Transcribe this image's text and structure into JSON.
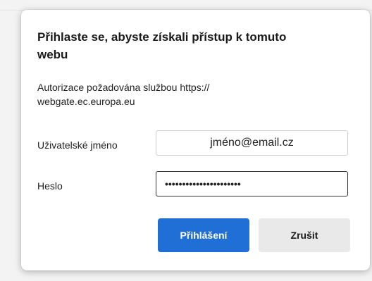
{
  "dialog": {
    "title": "Přihlaste se, abyste získali přístup k tomuto webu",
    "description": "Autorizace požadována službou https:// webgate.ec.europa.eu",
    "username_label": "Uživatelské jméno",
    "username_value": "jméno@email.cz",
    "password_label": "Heslo",
    "password_value": "••••••••••••••••••••••",
    "login_button": "Přihlášení",
    "cancel_button": "Zrušit"
  },
  "colors": {
    "primary_button": "#1f6fd6",
    "secondary_button": "#e9e9e9"
  }
}
